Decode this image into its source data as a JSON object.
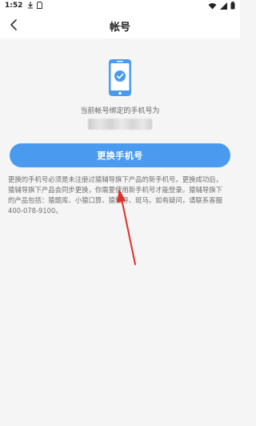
{
  "status_bar": {
    "time": "1:52"
  },
  "nav": {
    "title": "帐号"
  },
  "phone_bind": {
    "label": "当前帐号绑定的手机号为"
  },
  "actions": {
    "change_phone_label": "更换手机号"
  },
  "note": {
    "text": "更换的手机号必须是未注册过猿辅导旗下产品的新手机号。更换成功后，\n猿辅导旗下产品会同步更换，你需要使用新手机号才能登录。猿辅导旗下\n的产品包括：猿题库、小猿口算、猿辅导、斑马。如有疑问，请联系客服\n400-078-9100。"
  },
  "colors": {
    "accent": "#4a9bf0",
    "arrow": "#e0302a",
    "background": "#f5f5f5"
  }
}
